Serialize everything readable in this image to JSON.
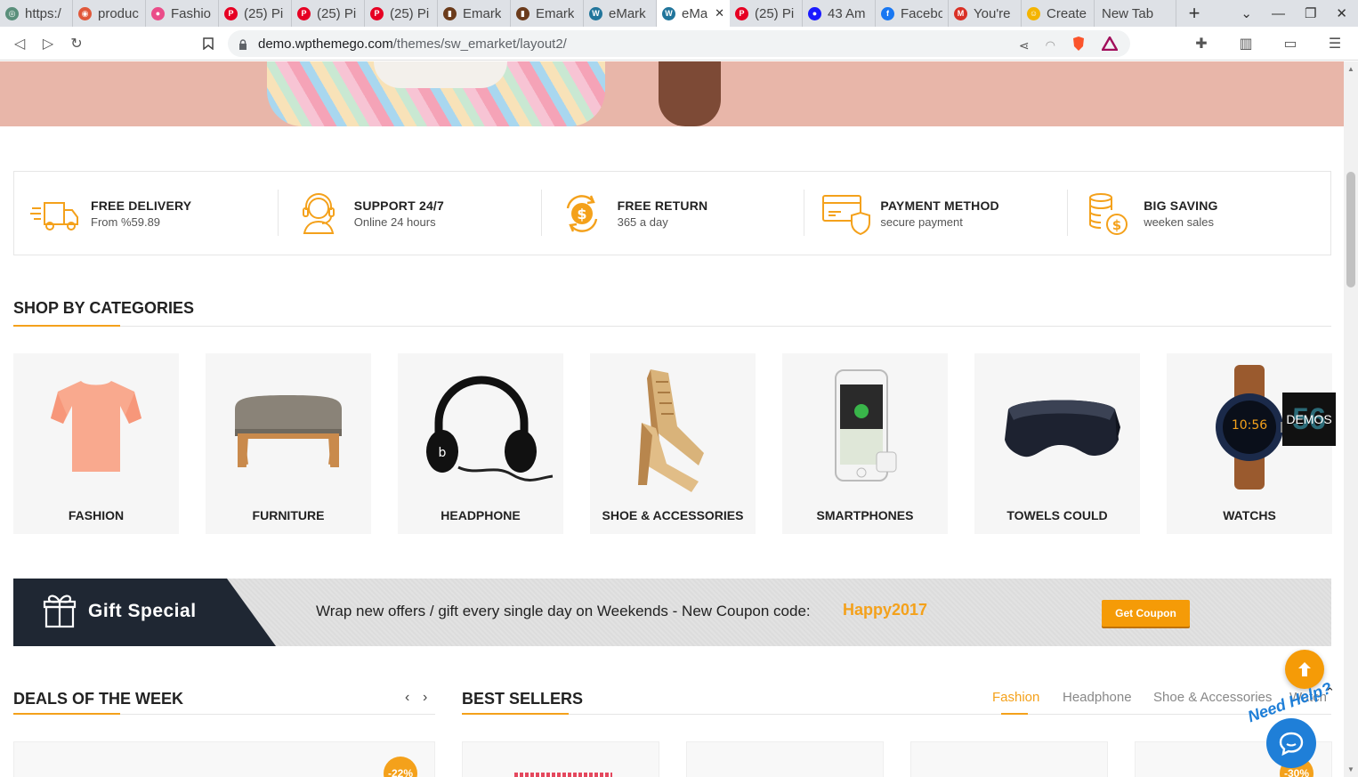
{
  "browser": {
    "tabs": [
      {
        "label": "https:/",
        "color": "#5a8f7b",
        "glyph": "◎"
      },
      {
        "label": "produc",
        "color": "#e0583a",
        "glyph": "◉"
      },
      {
        "label": "Fashio",
        "color": "#ea4c89",
        "glyph": "●"
      },
      {
        "label": "(25) Pi",
        "color": "#e60023",
        "glyph": "P"
      },
      {
        "label": "(25) Pi",
        "color": "#e60023",
        "glyph": "P"
      },
      {
        "label": "(25) Pi",
        "color": "#e60023",
        "glyph": "P"
      },
      {
        "label": "Emark",
        "color": "#6b3b1b",
        "glyph": "▮"
      },
      {
        "label": "Emark",
        "color": "#6b3b1b",
        "glyph": "▮"
      },
      {
        "label": "eMark",
        "color": "#21759b",
        "glyph": "W"
      },
      {
        "label": "eMa",
        "color": "#21759b",
        "glyph": "W",
        "active": true
      },
      {
        "label": "(25) Pi",
        "color": "#e60023",
        "glyph": "P"
      },
      {
        "label": "43 Am",
        "color": "#1a1aff",
        "glyph": "●"
      },
      {
        "label": "Facebo",
        "color": "#1877f2",
        "glyph": "f"
      },
      {
        "label": "You're",
        "color": "#d93025",
        "glyph": "M"
      },
      {
        "label": "Create",
        "color": "#f4b400",
        "glyph": "☺"
      },
      {
        "label": "New Tab",
        "color": "",
        "glyph": ""
      }
    ],
    "url_host": "demo.wpthemego.com",
    "url_path": "/themes/sw_emarket/layout2/"
  },
  "services": [
    {
      "title": "FREE DELIVERY",
      "sub": "From %59.89",
      "icon": "truck-icon"
    },
    {
      "title": "SUPPORT 24/7",
      "sub": "Online 24 hours",
      "icon": "headset-icon"
    },
    {
      "title": "FREE RETURN",
      "sub": "365 a day",
      "icon": "dollar-return-icon"
    },
    {
      "title": "PAYMENT METHOD",
      "sub": "secure payment",
      "icon": "card-shield-icon"
    },
    {
      "title": "BIG SAVING",
      "sub": "weeken sales",
      "icon": "coins-icon"
    }
  ],
  "categories_title": "SHOP BY CATEGORIES",
  "categories": [
    {
      "name": "FASHION"
    },
    {
      "name": "FURNITURE"
    },
    {
      "name": "HEADPHONE"
    },
    {
      "name": "SHOE & ACCESSORIES"
    },
    {
      "name": "SMARTPHONES"
    },
    {
      "name": "TOWELS COULD"
    },
    {
      "name": "WATCHS"
    }
  ],
  "demos": {
    "number": "56",
    "label": "DEMOS"
  },
  "gift": {
    "title": "Gift Special",
    "text": "Wrap new offers / gift every single day on Weekends - New Coupon code:",
    "code": "Happy2017",
    "button": "Get Coupon"
  },
  "deals_title": "DEALS OF THE WEEK",
  "bestsellers_title": "BEST SELLERS",
  "bestseller_tabs": [
    "Fashion",
    "Headphone",
    "Shoe & Accessories",
    "Watch"
  ],
  "badges": {
    "deal": "-22%",
    "best": "-30%"
  },
  "help_text": "Need Help?",
  "colors": {
    "accent": "#f4a11b",
    "dark": "#1f2733",
    "chat": "#1f7fd8"
  }
}
